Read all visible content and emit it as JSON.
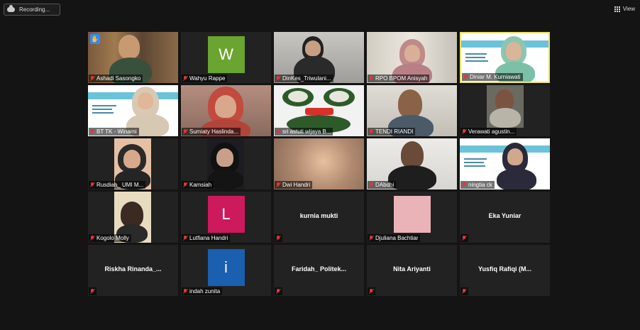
{
  "header": {
    "recording_label": "Recording...",
    "view_label": "View"
  },
  "tiles": [
    {
      "name": "Ashadi Sasongko",
      "muted": true,
      "video": true,
      "raised_hand": true
    },
    {
      "name": "Wahyu Rappe",
      "muted": true,
      "video": false,
      "avatar_letter": "W",
      "avatar_color": "#6aa431"
    },
    {
      "name": "DinKes_Triwulani...",
      "muted": true,
      "video": true
    },
    {
      "name": "RPO BPOM Anisyah",
      "muted": true,
      "video": true
    },
    {
      "name": "Diniar M. Kurniawati",
      "muted": true,
      "video": true,
      "active_speaker": true
    },
    {
      "name": "BT TK - Winarni",
      "muted": true,
      "video": true
    },
    {
      "name": "Sumiaty Haslinda...",
      "muted": true,
      "video": true
    },
    {
      "name": "sri astuti wijaya B...",
      "muted": true,
      "video": true
    },
    {
      "name": "TENDI RIANDI",
      "muted": true,
      "video": true
    },
    {
      "name": "Verawati agustin...",
      "muted": true,
      "video": true
    },
    {
      "name": "Rusdiah_ UMI M...",
      "muted": true,
      "video": true
    },
    {
      "name": "Kamsiah",
      "muted": true,
      "video": true
    },
    {
      "name": "Dwi Handri",
      "muted": true,
      "video": true
    },
    {
      "name": "DAbdhi",
      "muted": true,
      "video": true
    },
    {
      "name": "ningtia ck",
      "muted": true,
      "video": true
    },
    {
      "name": "Kogolo Molly",
      "muted": true,
      "video": true
    },
    {
      "name": "Lutfiana Handri",
      "muted": true,
      "video": false,
      "avatar_letter": "L",
      "avatar_color": "#cc1a5c"
    },
    {
      "name": "kurnia mukti",
      "muted": true,
      "video": false,
      "center_text": "kurnia mukti"
    },
    {
      "name": "Djuliana Bachtiar",
      "muted": true,
      "video": false,
      "avatar_color": "#e9b3b8"
    },
    {
      "name": "Eka Yuniar",
      "muted": true,
      "video": false,
      "center_text": "Eka Yuniar"
    },
    {
      "name": "Riskha Rinanda_...",
      "muted": true,
      "video": false,
      "center_text": "Riskha  Rinanda_..."
    },
    {
      "name": "indah zunita",
      "muted": true,
      "video": false,
      "avatar_letter": "i",
      "avatar_color": "#1a5fb0"
    },
    {
      "name": "Faridah_ Politek...",
      "muted": true,
      "video": false,
      "center_text": "Faridah_  Politek..."
    },
    {
      "name": "Nita Ariyanti",
      "muted": true,
      "video": false,
      "center_text": "Nita Ariyanti"
    },
    {
      "name": "Yusfiq Rafiqi (M...",
      "muted": true,
      "video": false,
      "center_text": "Yusfiq  Rafiqi  (M..."
    }
  ],
  "colors": {
    "background": "#141414",
    "tile": "#222222",
    "active_border": "#e8e36c",
    "muted_icon": "#e0373a"
  }
}
